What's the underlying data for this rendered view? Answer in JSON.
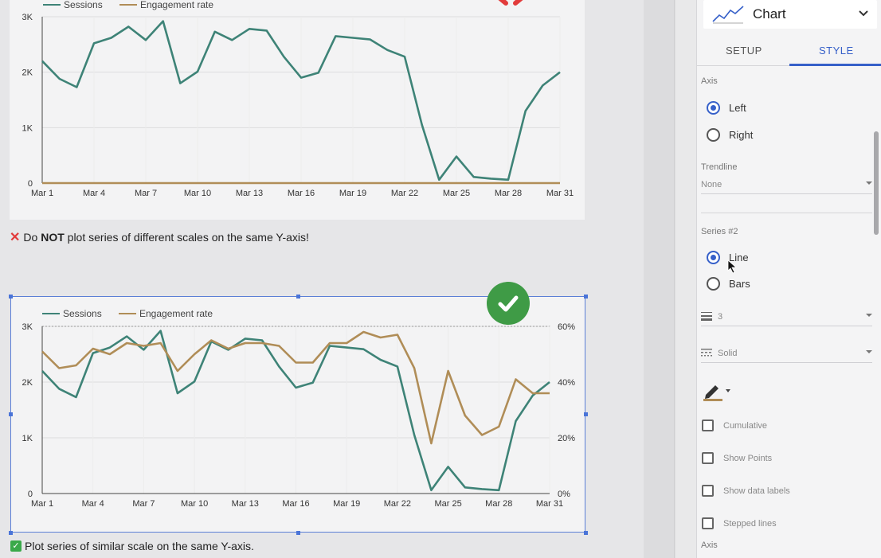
{
  "panel": {
    "chart_type": "Chart",
    "tabs": [
      "SETUP",
      "STYLE"
    ],
    "axis_label": "Axis",
    "axis_options": [
      "Left",
      "Right"
    ],
    "trendline_label": "Trendline",
    "trendline_value": "None",
    "series_label": "Series #2",
    "series_options": [
      "Line",
      "Bars"
    ],
    "line_weight": "3",
    "line_style": "Solid",
    "checkboxes": [
      "Cumulative",
      "Show Points",
      "Show data labels",
      "Stepped lines"
    ],
    "bottom_label": "Axis"
  },
  "captions": {
    "bad_prefix": "Do ",
    "bad_bold": "NOT",
    "bad_suffix": " plot series of different scales on the same Y-axis!",
    "good": "Plot series of similar scale on the same Y-axis."
  },
  "colors": {
    "sessions": "#3e8377",
    "engagement": "#b08d57",
    "accent": "#3660c9",
    "check_green": "#3f9b46",
    "cross_red": "#e23b3b"
  },
  "chart_data": [
    {
      "type": "line",
      "x": [
        "Mar 1",
        "Mar 2",
        "Mar 3",
        "Mar 4",
        "Mar 5",
        "Mar 6",
        "Mar 7",
        "Mar 8",
        "Mar 9",
        "Mar 10",
        "Mar 11",
        "Mar 12",
        "Mar 13",
        "Mar 14",
        "Mar 15",
        "Mar 16",
        "Mar 17",
        "Mar 18",
        "Mar 19",
        "Mar 20",
        "Mar 21",
        "Mar 22",
        "Mar 23",
        "Mar 24",
        "Mar 25",
        "Mar 26",
        "Mar 27",
        "Mar 28",
        "Mar 29",
        "Mar 30",
        "Mar 31"
      ],
      "x_ticks": [
        "Mar 1",
        "Mar 4",
        "Mar 7",
        "Mar 10",
        "Mar 13",
        "Mar 16",
        "Mar 19",
        "Mar 22",
        "Mar 25",
        "Mar 28",
        "Mar 31"
      ],
      "y_ticks": [
        "0",
        "1K",
        "2K",
        "3K"
      ],
      "ylim": [
        0,
        3000
      ],
      "series": [
        {
          "name": "Sessions",
          "values": [
            2200,
            1880,
            1730,
            2520,
            2620,
            2820,
            2580,
            2920,
            1800,
            2010,
            2730,
            2580,
            2780,
            2750,
            2280,
            1900,
            1990,
            2650,
            2620,
            2590,
            2400,
            2280,
            1050,
            60,
            480,
            110,
            80,
            60,
            1300,
            1760,
            2000
          ]
        },
        {
          "name": "Engagement rate",
          "values": [
            0.55,
            0.5,
            0.52,
            0.58,
            0.54,
            0.58,
            0.57,
            0.56,
            0.48,
            0.56,
            0.58,
            0.56,
            0.58,
            0.58,
            0.56,
            0.52,
            0.52,
            0.6,
            0.6,
            0.65,
            0.62,
            0.63,
            0.45,
            0.19,
            0.44,
            0.28,
            0.22,
            0.24,
            0.41,
            0.37,
            0.37
          ]
        }
      ],
      "grid": true,
      "legend": "top-left"
    },
    {
      "type": "line",
      "x": [
        "Mar 1",
        "Mar 2",
        "Mar 3",
        "Mar 4",
        "Mar 5",
        "Mar 6",
        "Mar 7",
        "Mar 8",
        "Mar 9",
        "Mar 10",
        "Mar 11",
        "Mar 12",
        "Mar 13",
        "Mar 14",
        "Mar 15",
        "Mar 16",
        "Mar 17",
        "Mar 18",
        "Mar 19",
        "Mar 20",
        "Mar 21",
        "Mar 22",
        "Mar 23",
        "Mar 24",
        "Mar 25",
        "Mar 26",
        "Mar 27",
        "Mar 28",
        "Mar 29",
        "Mar 30",
        "Mar 31"
      ],
      "x_ticks": [
        "Mar 1",
        "Mar 4",
        "Mar 7",
        "Mar 10",
        "Mar 13",
        "Mar 16",
        "Mar 19",
        "Mar 22",
        "Mar 25",
        "Mar 28",
        "Mar 31"
      ],
      "y_ticks": [
        "0",
        "1K",
        "2K",
        "3K"
      ],
      "y2_ticks": [
        "0%",
        "20%",
        "40%",
        "60%"
      ],
      "ylim": [
        0,
        3000
      ],
      "y2lim": [
        0,
        0.6
      ],
      "series": [
        {
          "name": "Sessions",
          "axis": "left",
          "values": [
            2200,
            1880,
            1730,
            2520,
            2620,
            2820,
            2580,
            2920,
            1800,
            2010,
            2730,
            2580,
            2780,
            2750,
            2280,
            1900,
            1990,
            2650,
            2620,
            2590,
            2400,
            2280,
            1050,
            60,
            480,
            110,
            80,
            60,
            1300,
            1760,
            2000
          ]
        },
        {
          "name": "Engagement rate",
          "axis": "right",
          "values": [
            0.51,
            0.45,
            0.46,
            0.52,
            0.5,
            0.54,
            0.53,
            0.54,
            0.44,
            0.5,
            0.55,
            0.52,
            0.54,
            0.54,
            0.53,
            0.47,
            0.47,
            0.54,
            0.54,
            0.58,
            0.56,
            0.57,
            0.45,
            0.18,
            0.44,
            0.28,
            0.21,
            0.24,
            0.41,
            0.36,
            0.36
          ]
        }
      ],
      "grid": true,
      "legend": "top-left"
    }
  ]
}
